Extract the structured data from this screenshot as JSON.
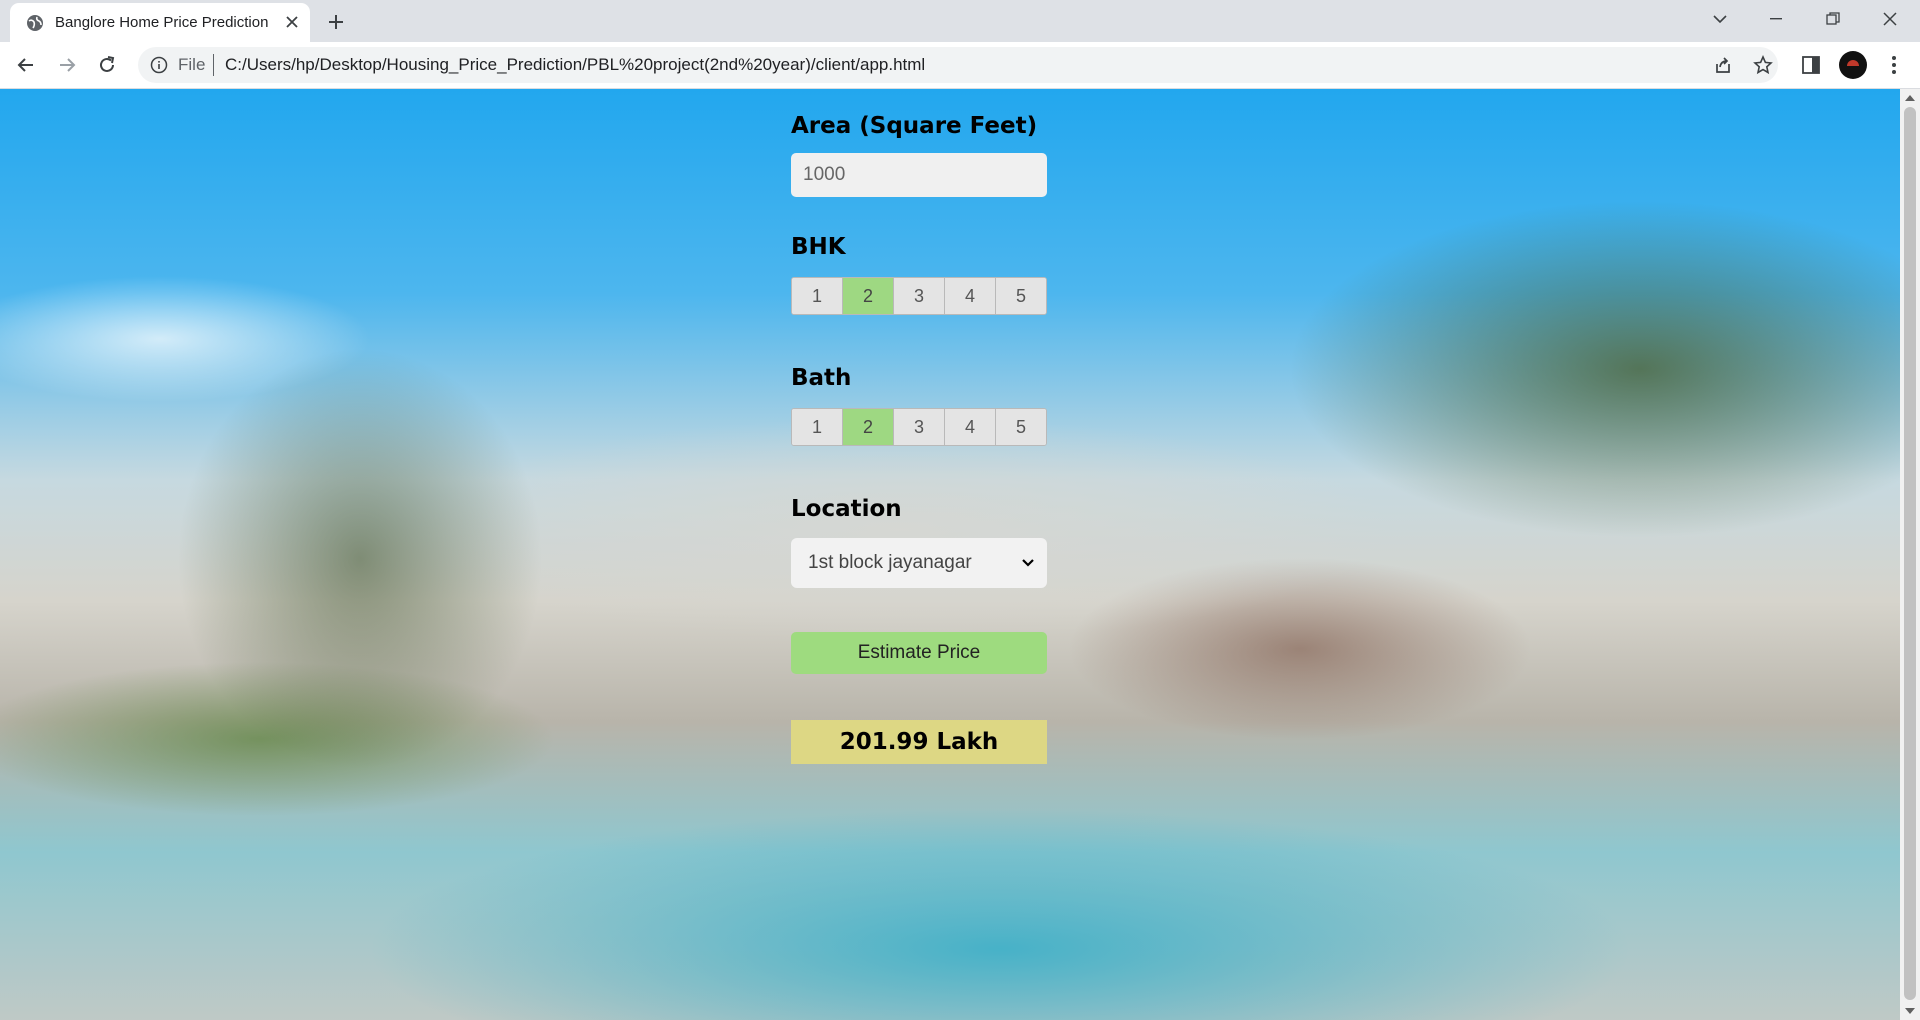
{
  "browser": {
    "tab_title": "Banglore Home Price Prediction",
    "scheme_label": "File",
    "url": "C:/Users/hp/Desktop/Housing_Price_Prediction/PBL%20project(2nd%20year)/client/app.html"
  },
  "form": {
    "area": {
      "label": "Area (Square Feet)",
      "value": "1000"
    },
    "bhk": {
      "label": "BHK",
      "options": [
        "1",
        "2",
        "3",
        "4",
        "5"
      ],
      "selected": "2"
    },
    "bath": {
      "label": "Bath",
      "options": [
        "1",
        "2",
        "3",
        "4",
        "5"
      ],
      "selected": "2"
    },
    "location": {
      "label": "Location",
      "selected": "1st block jayanagar"
    },
    "estimate_label": "Estimate Price",
    "result": "201.99 Lakh"
  },
  "colors": {
    "selected_option": "#9ed882",
    "estimate_button": "#9edb7f",
    "result_box": "#ddd784"
  }
}
